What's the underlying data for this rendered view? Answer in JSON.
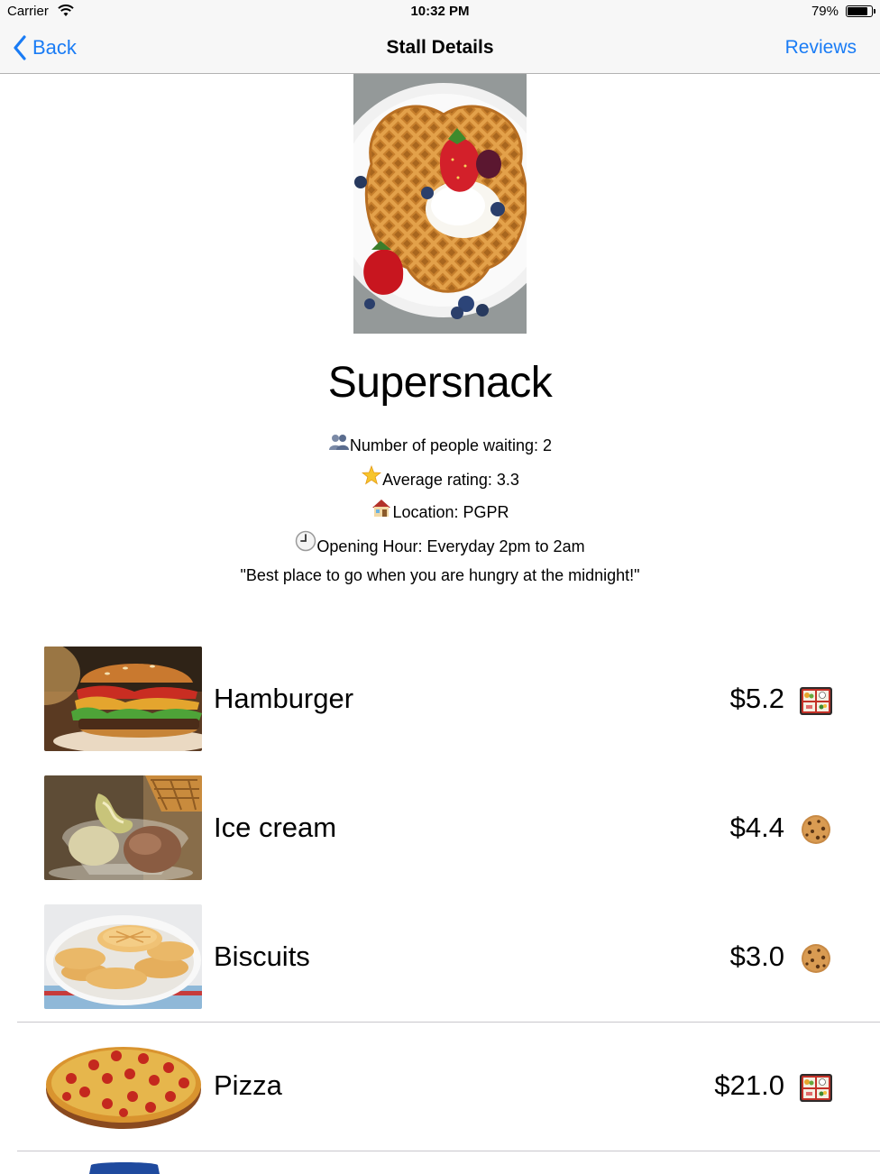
{
  "status_bar": {
    "carrier": "Carrier",
    "time": "10:32 PM",
    "battery_pct": "79%",
    "battery_level": 0.79
  },
  "nav": {
    "back_label": "Back",
    "title": "Stall Details",
    "right_label": "Reviews"
  },
  "stall": {
    "name": "Supersnack",
    "waiting": "Number of people waiting: 2",
    "rating": "Average rating: 3.3",
    "location": "Location: PGPR",
    "hours": "Opening Hour: Everyday 2pm to 2am",
    "quote": "\"Best place to go when you are hungry at the midnight!\"",
    "icons": {
      "waiting": "people-icon",
      "rating": "star-icon",
      "location": "house-icon",
      "hours": "clock-icon"
    }
  },
  "menu": [
    {
      "name": "Hamburger",
      "price": "$5.2",
      "type_icon": "bento-box-icon"
    },
    {
      "name": "Ice cream",
      "price": "$4.4",
      "type_icon": "cookie-icon"
    },
    {
      "name": "Biscuits",
      "price": "$3.0",
      "type_icon": "cookie-icon"
    },
    {
      "name": "Pizza",
      "price": "$21.0",
      "type_icon": "bento-box-icon"
    }
  ],
  "colors": {
    "accent": "#1a7cf5",
    "bar_background": "#f7f7f7",
    "separator": "#c8c7cc"
  }
}
